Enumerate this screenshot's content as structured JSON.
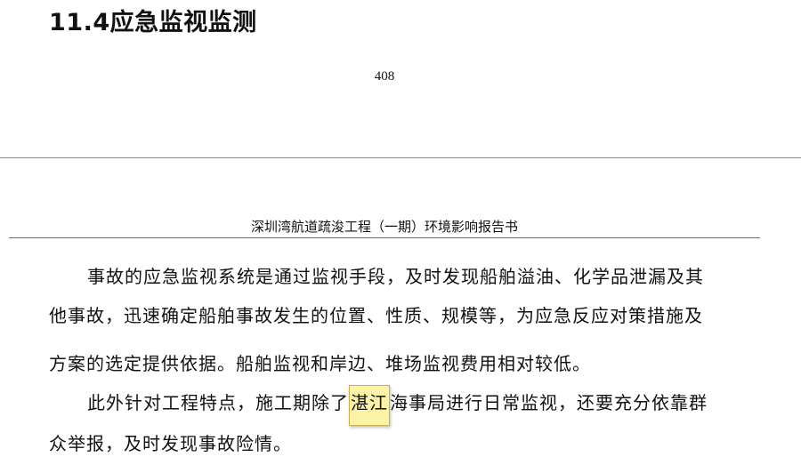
{
  "section_heading": "11.4应急监视监测",
  "page_number": "408",
  "running_header": "深圳湾航道疏浚工程（一期）环境影响报告书",
  "paragraph1": {
    "line1": "事故的应急监视系统是通过监视手段，及时发现船舶溢油、化学品泄漏及其",
    "line2": "他事故，迅速确定船舶事故发生的位置、性质、规模等，为应急反应对策措施及",
    "line3": "方案的选定提供依据。船舶监视和岸边、堆场监视费用相对较低。"
  },
  "paragraph2": {
    "line1_before": "此外针对工程特点，施工期除了",
    "line1_highlight": "湛江",
    "line1_after": "海事局进行日常监视，还要充分依靠群",
    "line2": "众举报，及时发现事故险情。"
  },
  "colors": {
    "highlight_fill": "#fdf3a6",
    "highlight_border": "#c9b24a",
    "rule": "#8a8a8a"
  }
}
